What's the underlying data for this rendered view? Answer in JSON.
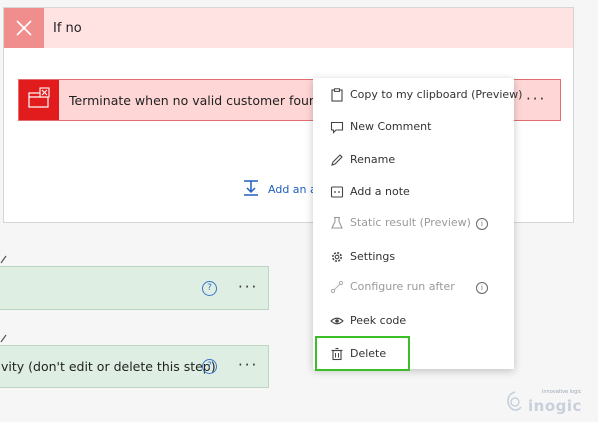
{
  "branch": {
    "title": "If no"
  },
  "action": {
    "title": "Terminate when no valid customer found",
    "more": "···"
  },
  "add_action": {
    "label": "Add an ac"
  },
  "steps": [
    {
      "title": "",
      "help": "?",
      "more": "···"
    },
    {
      "title": "vity (don't edit or delete this step)",
      "help": "?",
      "more": "···"
    }
  ],
  "menu": {
    "items": [
      {
        "label": "Copy to my clipboard (Preview)",
        "icon": "clipboard-icon",
        "enabled": true
      },
      {
        "label": "New Comment",
        "icon": "comment-icon",
        "enabled": true
      },
      {
        "label": "Rename",
        "icon": "pencil-icon",
        "enabled": true
      },
      {
        "label": "Add a note",
        "icon": "note-icon",
        "enabled": true
      },
      {
        "label": "Static result (Preview)",
        "icon": "flask-icon",
        "enabled": false,
        "info": "i"
      },
      {
        "label": "Settings",
        "icon": "gear-icon",
        "enabled": true
      },
      {
        "label": "Configure run after",
        "icon": "run-after-icon",
        "enabled": false,
        "info": "i"
      },
      {
        "label": "Peek code",
        "icon": "eye-icon",
        "enabled": true
      },
      {
        "label": "Delete",
        "icon": "trash-icon",
        "enabled": true,
        "highlighted": true
      }
    ]
  },
  "watermark": {
    "tagline": "innovative logic",
    "brand": "inogic"
  },
  "colors": {
    "branch_header": "#ffe3e3",
    "close_box": "#f08e8e",
    "action_bg": "#ffd6d6",
    "action_icon_bg": "#e21c1c",
    "step_bg": "#dfeee2",
    "link": "#1f5fbf",
    "highlight": "#3bbf27"
  }
}
